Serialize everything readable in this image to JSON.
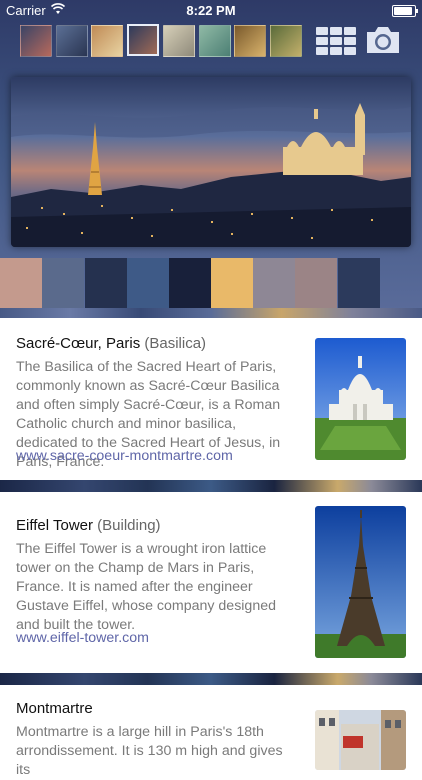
{
  "status": {
    "carrier": "Carrier",
    "time": "8:22 PM"
  },
  "toolbar": {
    "thumbnails": [
      {
        "colors": [
          "#3a4466",
          "#b7695c"
        ]
      },
      {
        "colors": [
          "#5b6f95",
          "#2a3552"
        ]
      },
      {
        "colors": [
          "#c08b56",
          "#e8d3a2"
        ]
      },
      {
        "colors": [
          "#2e3a5c",
          "#a06a55"
        ]
      },
      {
        "colors": [
          "#d6cfb8",
          "#8f8a7a"
        ]
      },
      {
        "colors": [
          "#8fb9a5",
          "#4c7f74"
        ]
      },
      {
        "colors": [
          "#7a5a2c",
          "#d9b36c"
        ]
      },
      {
        "colors": [
          "#5a6b3a",
          "#c3b06b"
        ]
      }
    ],
    "selected_index": 3
  },
  "palette": [
    "#c49a8d",
    "#5a6a8c",
    "#25314f",
    "#3e5a87",
    "#18203a",
    "#e9b969",
    "#8e8795",
    "#9b8486",
    "#2c3a5c"
  ],
  "places": [
    {
      "title": "Sacré-Cœur, Paris",
      "category": "(Basilica)",
      "description": "The Basilica of the Sacred Heart of Paris, commonly known as Sacré-Cœur Basilica and often simply Sacré-Cœur, is a Roman Catholic church and minor basilica, dedicated to the Sacred Heart of Jesus, in Paris, France.",
      "url": "www.sacre-coeur-montmartre.com",
      "photo_icon": "basilica-photo"
    },
    {
      "title": "Eiffel Tower",
      "category": "(Building)",
      "description": "The Eiffel Tower is a wrought iron lattice tower on the Champ de Mars in Paris, France. It is named after the engineer Gustave Eiffel, whose company designed and built the tower.",
      "url": "www.eiffel-tower.com",
      "photo_icon": "tower-photo"
    },
    {
      "title": "Montmartre",
      "category": "",
      "description": "Montmartre is a large hill in Paris's 18th arrondissement. It is 130 m high and gives its",
      "url": "",
      "photo_icon": "street-photo"
    }
  ]
}
